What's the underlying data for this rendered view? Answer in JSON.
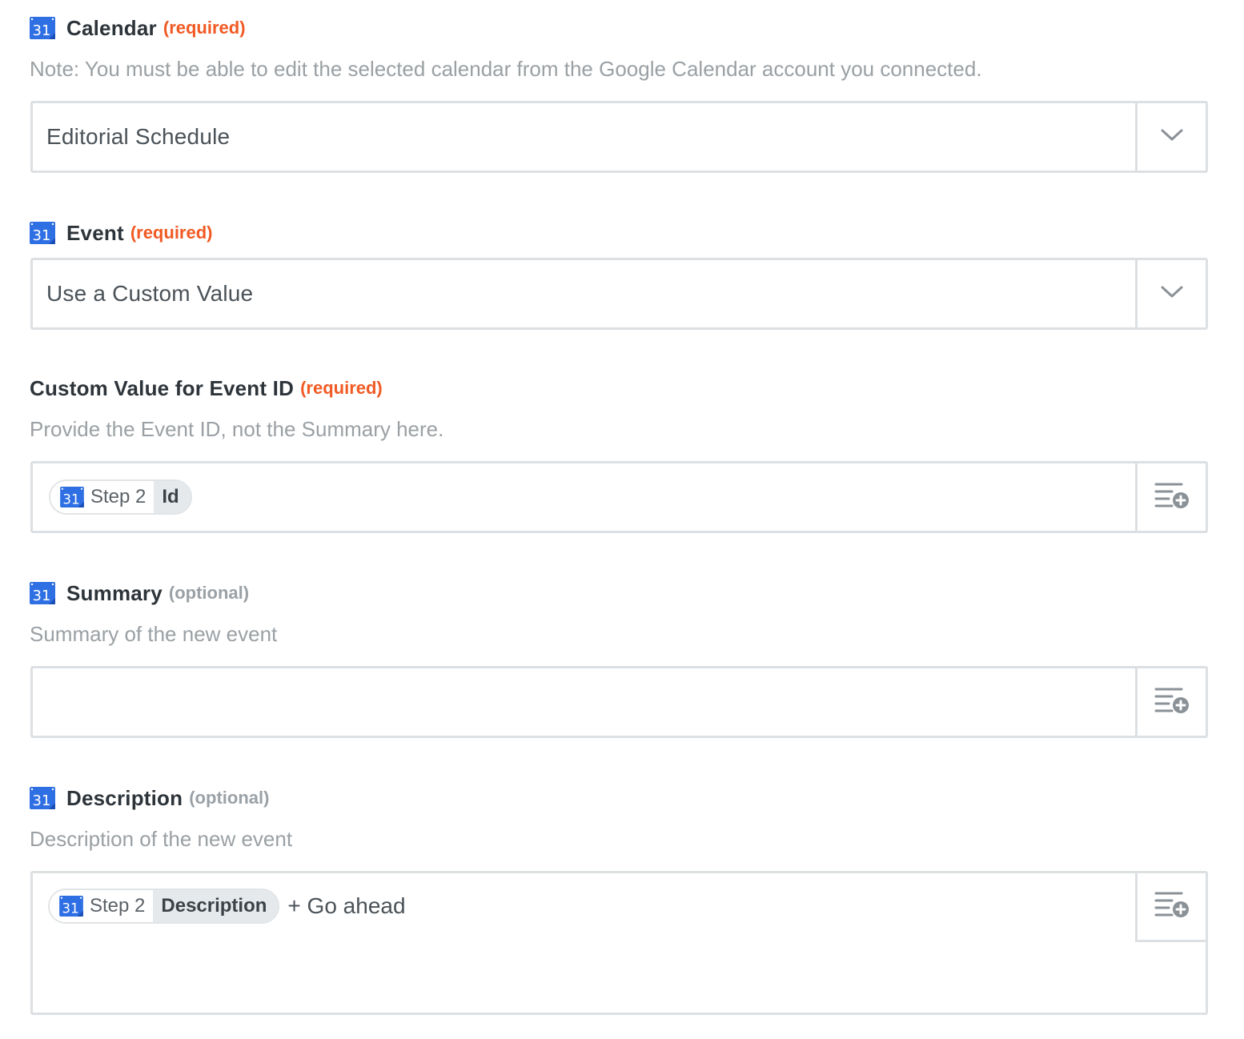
{
  "fields": {
    "calendar": {
      "label": "Calendar",
      "badge": "(required)",
      "help": "Note: You must be able to edit the selected calendar from the Google Calendar account you connected.",
      "value": "Editorial Schedule"
    },
    "event": {
      "label": "Event",
      "badge": "(required)",
      "value": "Use a Custom Value"
    },
    "custom_event_id": {
      "label": "Custom Value for Event ID",
      "badge": "(required)",
      "help": "Provide the Event ID, not the Summary here.",
      "pill": {
        "step": "Step 2",
        "field": "Id"
      }
    },
    "summary": {
      "label": "Summary",
      "badge": "(optional)",
      "help": "Summary of the new event",
      "value": ""
    },
    "description": {
      "label": "Description",
      "badge": "(optional)",
      "help": "Description of the new event",
      "pill": {
        "step": "Step 2",
        "field": "Description"
      },
      "extra_text": "+ Go ahead"
    }
  },
  "icons": {
    "app_icon": "google-calendar-icon",
    "select_toggle": "chevron-down-icon",
    "insert_data": "insert-data-icon"
  },
  "colors": {
    "required": "#f15a24",
    "optional": "#9aa1a6",
    "calendar_blue": "#2f6fe4",
    "border": "#dde0e2"
  }
}
